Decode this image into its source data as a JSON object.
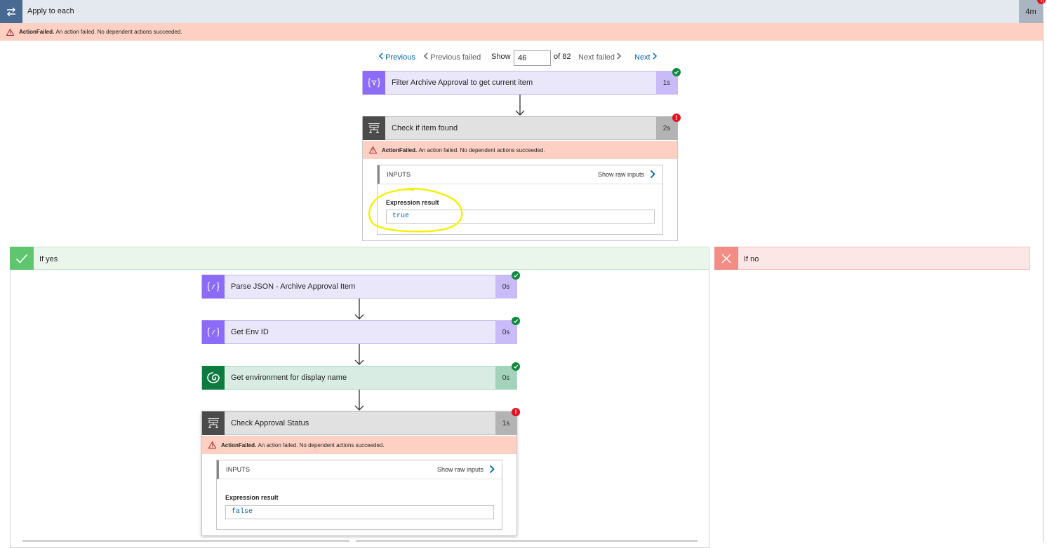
{
  "apply_to_each": {
    "title": "Apply to each",
    "duration": "4m",
    "status": "!",
    "error": {
      "code": "ActionFailed.",
      "message": "An action failed. No dependent actions succeeded."
    }
  },
  "pager": {
    "previous": "Previous",
    "previous_failed": "Previous failed",
    "show_label": "Show",
    "current": "46",
    "of_total": "of 82",
    "next_failed": "Next failed",
    "next": "Next"
  },
  "filter_action": {
    "title": "Filter Archive Approval to get current item",
    "duration": "1s"
  },
  "check_item": {
    "title": "Check if item found",
    "duration": "2s",
    "status": "!",
    "error": {
      "code": "ActionFailed.",
      "message": "An action failed. No dependent actions succeeded."
    },
    "inputs": {
      "label": "INPUTS",
      "raw": "Show raw inputs",
      "expr_label": "Expression result",
      "expr_value": "true"
    }
  },
  "branches": {
    "yes": "If yes",
    "no": "If no"
  },
  "parse_json": {
    "title": "Parse JSON - Archive Approval Item",
    "duration": "0s"
  },
  "get_env_id": {
    "title": "Get Env ID",
    "duration": "0s"
  },
  "get_environment": {
    "title": "Get environment for display name",
    "duration": "0s"
  },
  "check_approval": {
    "title": "Check Approval Status",
    "duration": "1s",
    "status": "!",
    "error": {
      "code": "ActionFailed.",
      "message": "An action failed. No dependent actions succeeded."
    },
    "inputs": {
      "label": "INPUTS",
      "raw": "Show raw inputs",
      "expr_label": "Expression result",
      "expr_value": "false"
    }
  },
  "colors": {
    "error_banner": "#fdd0c3",
    "link": "#0062b1",
    "success": "#0e8a3c",
    "failure": "#e81123",
    "annotation": "#f5f000"
  },
  "icons": {
    "apply": "loop-icon",
    "data_operation": "curly-braces-icon",
    "condition": "condition-icon",
    "dataverse": "dataverse-icon",
    "yes": "checkmark-icon",
    "no": "cross-icon"
  }
}
